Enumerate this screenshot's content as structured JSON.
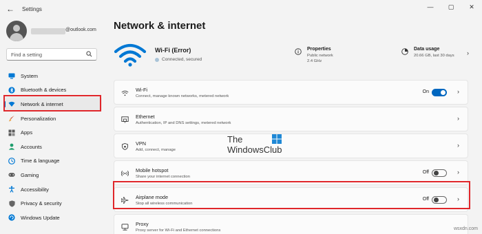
{
  "window": {
    "title": "Settings",
    "controls": {
      "minimize": "—",
      "maximize": "▢",
      "close": "✕"
    }
  },
  "profile": {
    "email": "@outlook.com"
  },
  "search": {
    "placeholder": "Find a setting"
  },
  "sidebar": {
    "items": [
      {
        "label": "System",
        "icon": "monitor-icon",
        "color": "#0078d4"
      },
      {
        "label": "Bluetooth & devices",
        "icon": "bluetooth-icon",
        "color": "#0078d4"
      },
      {
        "label": "Network & internet",
        "icon": "network-icon",
        "color": "#0078d4",
        "active": true
      },
      {
        "label": "Personalization",
        "icon": "brush-icon",
        "color": "#d04f2e"
      },
      {
        "label": "Apps",
        "icon": "apps-icon",
        "color": "#5a5a5a"
      },
      {
        "label": "Accounts",
        "icon": "person-icon",
        "color": "#1f9e6d"
      },
      {
        "label": "Time & language",
        "icon": "globe-clock-icon",
        "color": "#0078d4"
      },
      {
        "label": "Gaming",
        "icon": "gamepad-icon",
        "color": "#555555"
      },
      {
        "label": "Accessibility",
        "icon": "accessibility-icon",
        "color": "#0078d4"
      },
      {
        "label": "Privacy & security",
        "icon": "shield-icon",
        "color": "#555555"
      },
      {
        "label": "Windows Update",
        "icon": "update-icon",
        "color": "#0078d4"
      }
    ]
  },
  "page": {
    "title": "Network & internet"
  },
  "header": {
    "wifi_title": "Wi-Fi (Error)",
    "wifi_status": "Connected, secured",
    "properties": {
      "title": "Properties",
      "line1": "Public network",
      "line2": "2.4 GHz"
    },
    "data_usage": {
      "title": "Data usage",
      "line1": "20.66 GB, last 30 days"
    }
  },
  "cards": [
    {
      "title": "Wi-Fi",
      "sub": "Connect, manage known networks, metered network",
      "icon": "wifi-icon",
      "toggle": "On"
    },
    {
      "title": "Ethernet",
      "sub": "Authentication, IP and DNS settings, metered network",
      "icon": "ethernet-icon"
    },
    {
      "title": "VPN",
      "sub": "Add, connect, manage",
      "icon": "vpn-shield-icon"
    },
    {
      "title": "Mobile hotspot",
      "sub": "Share your internet connection",
      "icon": "hotspot-icon",
      "toggle": "Off"
    },
    {
      "title": "Airplane mode",
      "sub": "Stop all wireless communication",
      "icon": "airplane-icon",
      "toggle": "Off"
    },
    {
      "title": "Proxy",
      "sub": "Proxy server for Wi-Fi and Ethernet connections",
      "icon": "proxy-icon"
    }
  ],
  "watermark": {
    "line1": "The",
    "line2": "WindowsClub"
  },
  "site_watermark": "wsxdn.com",
  "colors": {
    "accent": "#0067c0",
    "highlight_box": "#e0262a",
    "wifi_blue": "#0078d4"
  }
}
